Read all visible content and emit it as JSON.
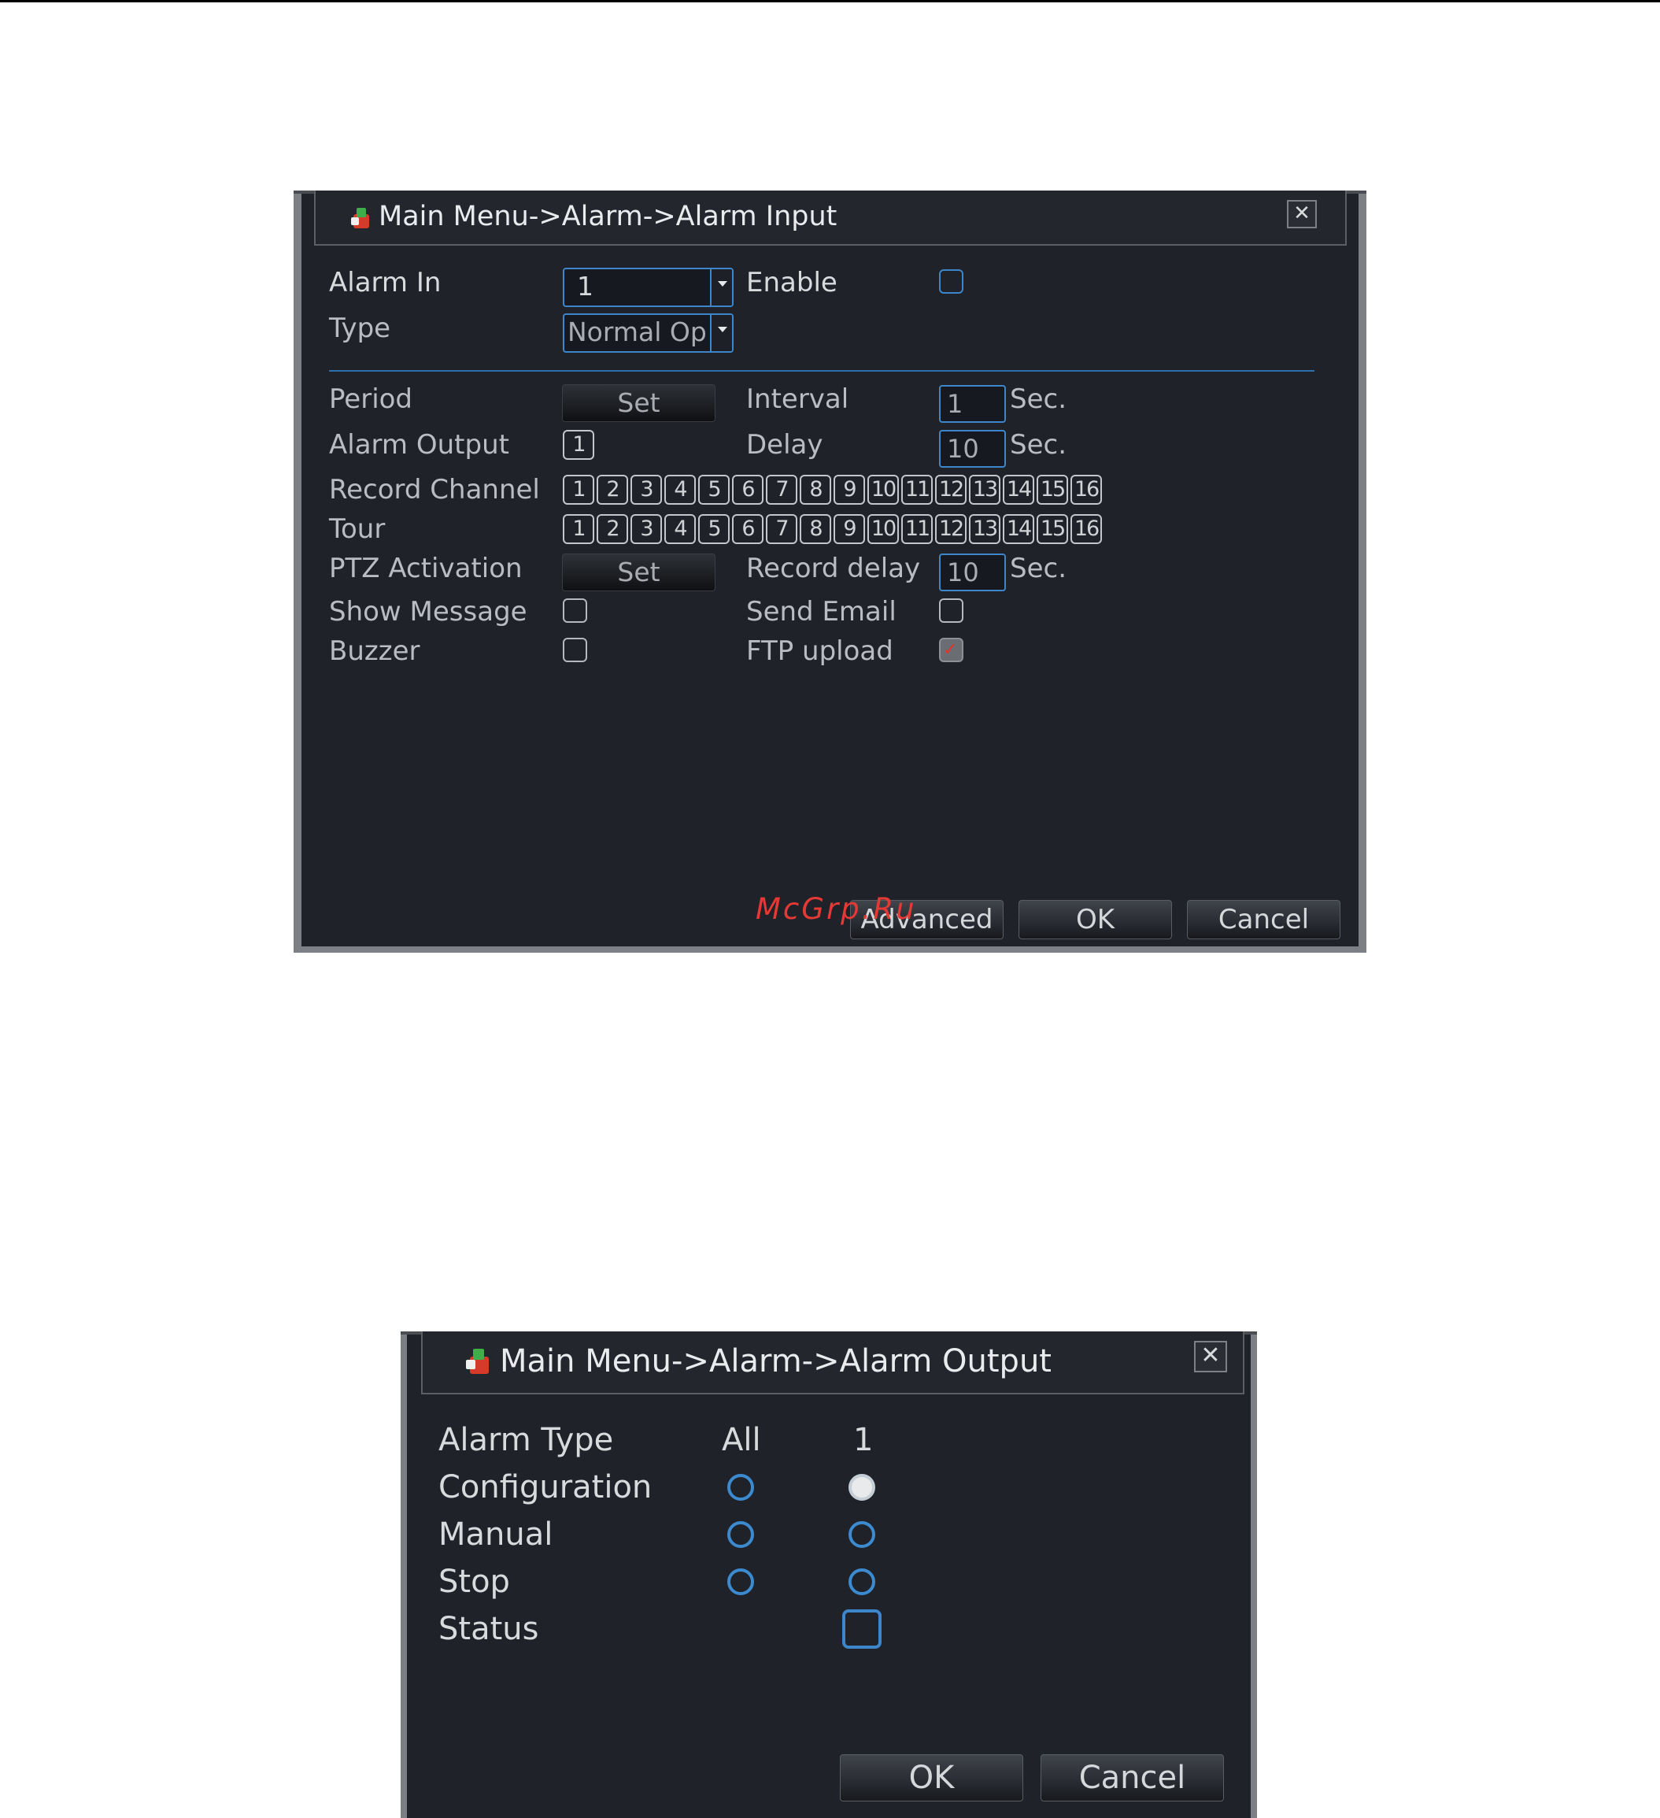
{
  "alarm_input": {
    "title": "Main Menu->Alarm->Alarm Input",
    "close_glyph": "✕",
    "alarm_in": {
      "label": "Alarm In",
      "value": "1"
    },
    "enable": {
      "label": "Enable",
      "checked": false
    },
    "type": {
      "label": "Type",
      "value": "Normal Op"
    },
    "period": {
      "label": "Period",
      "button": "Set"
    },
    "interval": {
      "label": "Interval",
      "value": "1",
      "unit": "Sec."
    },
    "alarm_output": {
      "label": "Alarm Output",
      "value": "1"
    },
    "delay": {
      "label": "Delay",
      "value": "10",
      "unit": "Sec."
    },
    "record_channel": {
      "label": "Record Channel",
      "channels": [
        "1",
        "2",
        "3",
        "4",
        "5",
        "6",
        "7",
        "8",
        "9",
        "10",
        "11",
        "12",
        "13",
        "14",
        "15",
        "16"
      ]
    },
    "tour": {
      "label": "Tour",
      "channels": [
        "1",
        "2",
        "3",
        "4",
        "5",
        "6",
        "7",
        "8",
        "9",
        "10",
        "11",
        "12",
        "13",
        "14",
        "15",
        "16"
      ]
    },
    "ptz_activation": {
      "label": "PTZ Activation",
      "button": "Set"
    },
    "record_delay": {
      "label": "Record delay",
      "value": "10",
      "unit": "Sec."
    },
    "show_message": {
      "label": "Show Message",
      "checked": false
    },
    "send_email": {
      "label": "Send Email",
      "checked": false
    },
    "buzzer": {
      "label": "Buzzer",
      "checked": false
    },
    "ftp_upload": {
      "label": "FTP upload",
      "checked": true,
      "check_glyph": "✓"
    },
    "buttons": {
      "advanced": "Advanced",
      "ok": "OK",
      "cancel": "Cancel"
    },
    "watermark": "McGrp.Ru"
  },
  "alarm_output": {
    "title": "Main Menu->Alarm->Alarm Output",
    "close_glyph": "✕",
    "header": {
      "label": "Alarm Type",
      "col_all": "All",
      "col_1": "1"
    },
    "rows": [
      {
        "label": "Configuration",
        "all_selected": false,
        "one_selected": true
      },
      {
        "label": "Manual",
        "all_selected": false,
        "one_selected": false
      },
      {
        "label": "Stop",
        "all_selected": false,
        "one_selected": false
      }
    ],
    "status": {
      "label": "Status",
      "checked": false
    },
    "buttons": {
      "ok": "OK",
      "cancel": "Cancel"
    }
  },
  "icons": {
    "title_icon": "alarm-menu-icon",
    "close": "close-icon",
    "dropdown": "chevron-down-icon"
  },
  "colors": {
    "panel": "#1f2229",
    "accent_blue": "#3d86c9",
    "check_red": "#e0342a",
    "watermark_red": "#e53935"
  }
}
